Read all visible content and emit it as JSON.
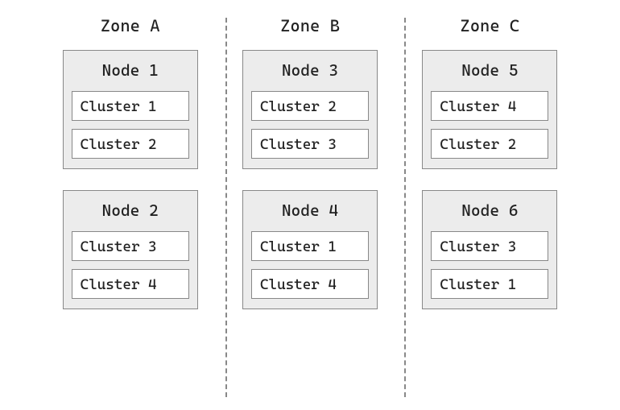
{
  "zones": [
    {
      "label": "Zone A",
      "nodes": [
        {
          "label": "Node 1",
          "clusters": [
            "Cluster 1",
            "Cluster 2"
          ]
        },
        {
          "label": "Node 2",
          "clusters": [
            "Cluster 3",
            "Cluster 4"
          ]
        }
      ]
    },
    {
      "label": "Zone B",
      "nodes": [
        {
          "label": "Node 3",
          "clusters": [
            "Cluster 2",
            "Cluster 3"
          ]
        },
        {
          "label": "Node 4",
          "clusters": [
            "Cluster 1",
            "Cluster 4"
          ]
        }
      ]
    },
    {
      "label": "Zone C",
      "nodes": [
        {
          "label": "Node 5",
          "clusters": [
            "Cluster 4",
            "Cluster 2"
          ]
        },
        {
          "label": "Node 6",
          "clusters": [
            "Cluster 3",
            "Cluster 1"
          ]
        }
      ]
    }
  ]
}
